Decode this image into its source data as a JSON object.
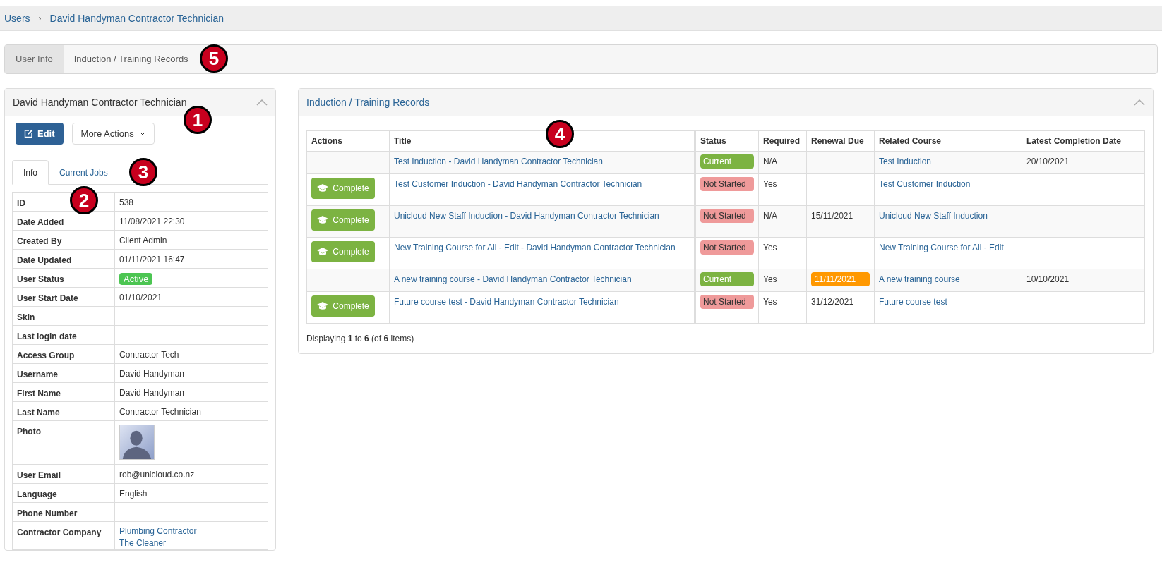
{
  "breadcrumb": [
    "Users",
    "David Handyman Contractor Technician"
  ],
  "breadcrumb_separator": "›",
  "page_tabs": [
    {
      "label": "User Info",
      "selected": true
    },
    {
      "label": "Induction / Training Records",
      "selected": false
    }
  ],
  "user_panel": {
    "title": "David Handyman Contractor Technician",
    "edit_button": "Edit",
    "more_button": "More Actions",
    "tabs": [
      {
        "label": "Info",
        "selected": true
      },
      {
        "label": "Current Jobs",
        "selected": false
      }
    ],
    "fields": [
      {
        "label": "ID",
        "kind": "text",
        "value": "538"
      },
      {
        "label": "Date Added",
        "kind": "text",
        "value": "11/08/2021 22:30"
      },
      {
        "label": "Created By",
        "kind": "text",
        "value": "Client Admin"
      },
      {
        "label": "Date Updated",
        "kind": "text",
        "value": "01/11/2021 16:47"
      },
      {
        "label": "User Status",
        "kind": "badge",
        "value": "Active"
      },
      {
        "label": "User Start Date",
        "kind": "text",
        "value": "01/10/2021"
      },
      {
        "label": "Skin",
        "kind": "text"
      },
      {
        "label": "Last login date",
        "kind": "text"
      },
      {
        "label": "Access Group",
        "kind": "text",
        "value": "Contractor Tech"
      },
      {
        "label": "Username",
        "kind": "text",
        "value": "David Handyman"
      },
      {
        "label": "First Name",
        "kind": "text",
        "value": "David Handyman"
      },
      {
        "label": "Last Name",
        "kind": "text",
        "value": "Contractor Technician"
      },
      {
        "label": "Photo",
        "kind": "photo"
      },
      {
        "label": "User Email",
        "kind": "text",
        "value": "rob@unicloud.co.nz"
      },
      {
        "label": "Language",
        "kind": "text",
        "value": "English"
      },
      {
        "label": "Phone Number",
        "kind": "text"
      },
      {
        "label": "Contractor Company",
        "kind": "links",
        "links": [
          "Plumbing Contractor",
          "The Cleaner"
        ]
      }
    ]
  },
  "records_panel": {
    "title": "Induction / Training Records",
    "columns": [
      "Actions",
      "Title",
      "Status",
      "Required",
      "Renewal Due",
      "Related Course",
      "Latest Completion Date"
    ],
    "rows": [
      {
        "title": "Test Induction - David Handyman Contractor Technician",
        "status": {
          "text": "Current",
          "color": "#7cb342"
        },
        "required": "N/A",
        "course": "Test Induction",
        "completed": "20/10/2021"
      },
      {
        "action": "Complete",
        "title": "Test Customer Induction - David Handyman Contractor Technician",
        "status": {
          "text": "Not Started",
          "color": "#ef9a9a"
        },
        "required": "Yes",
        "course": "Test Customer Induction"
      },
      {
        "action": "Complete",
        "title": "Unicloud New Staff Induction - David Handyman Contractor Technician",
        "status": {
          "text": "Not Started",
          "color": "#ef9a9a"
        },
        "required": "N/A",
        "renewal": {
          "text": "15/11/2021",
          "overdue": false
        },
        "course": "Unicloud New Staff Induction"
      },
      {
        "action": "Complete",
        "title": "New Training Course for All - Edit - David Handyman Contractor Technician",
        "status": {
          "text": "Not Started",
          "color": "#ef9a9a"
        },
        "required": "Yes",
        "course": "New Training Course for All - Edit"
      },
      {
        "title": "A new training course - David Handyman Contractor Technician",
        "status": {
          "text": "Current",
          "color": "#7cb342"
        },
        "required": "Yes",
        "renewal": {
          "text": "11/11/2021",
          "overdue": true
        },
        "course": "A new training course",
        "completed": "10/10/2021"
      },
      {
        "action": "Complete",
        "title": "Future course test - David Handyman Contractor Technician",
        "status": {
          "text": "Not Started",
          "color": "#ef9a9a"
        },
        "required": "Yes",
        "renewal": {
          "text": "31/12/2021",
          "overdue": false
        },
        "course": "Future course test"
      }
    ],
    "footer": "Displaying **1** to **6** (of **6** items)"
  },
  "markers": [
    "1",
    "2",
    "3",
    "4",
    "5"
  ]
}
